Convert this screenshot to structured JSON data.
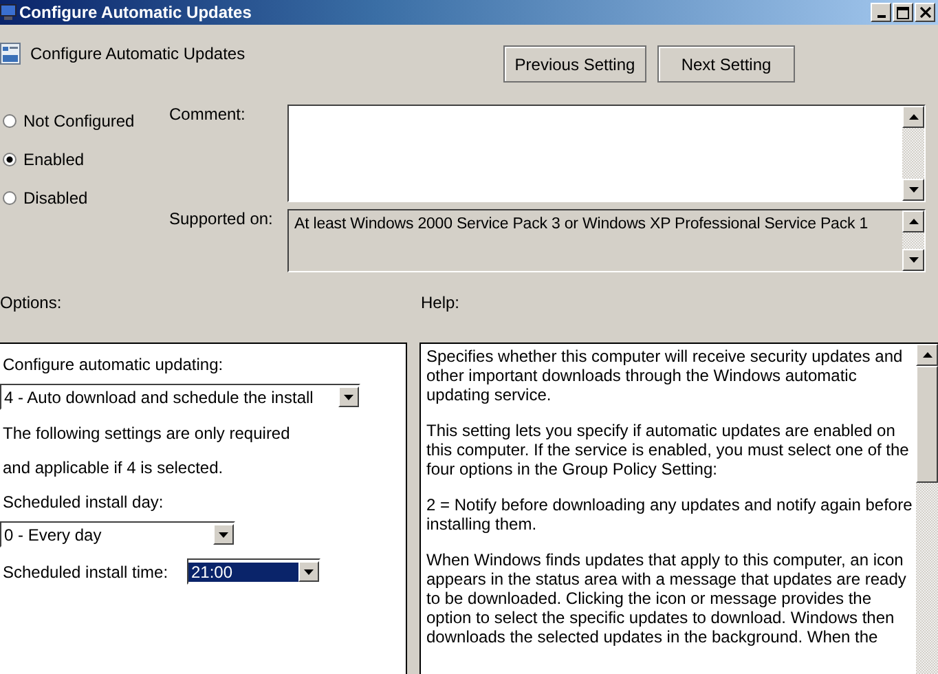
{
  "window": {
    "title": "Configure Automatic Updates"
  },
  "header": {
    "title": "Configure Automatic Updates",
    "buttons": [
      "Previous Setting",
      "Next Setting"
    ]
  },
  "state_options": [
    {
      "label": "Not Configured",
      "selected": false
    },
    {
      "label": "Enabled",
      "selected": true
    },
    {
      "label": "Disabled",
      "selected": false
    }
  ],
  "comment": {
    "label": "Comment:"
  },
  "supported_on": {
    "label": "Supported on:",
    "value": "At least Windows 2000 Service Pack 3 or Windows XP Professional Service Pack 1"
  },
  "options": {
    "label": "Options:",
    "items": [
      {
        "kind": "text",
        "text": "Configure automatic updating:"
      },
      {
        "kind": "dropdown",
        "value": "4 - Auto download and schedule the install"
      },
      {
        "kind": "text",
        "text": "The following settings are only required"
      },
      {
        "kind": "text",
        "text": "and applicable if 4 is selected."
      },
      {
        "kind": "text",
        "text": "Scheduled install day:"
      },
      {
        "kind": "dropdown",
        "value": "0 - Every day"
      },
      {
        "kind": "labeled_dropdown",
        "label": "Scheduled install time:",
        "value": "21:00",
        "focused": true
      }
    ]
  },
  "help": {
    "label": "Help:",
    "paragraphs": [
      "Specifies whether this computer will receive security updates and other important downloads through the Windows automatic updating service.",
      "This setting lets you specify if automatic updates are enabled on this computer. If the service is enabled, you must select one of the four options in the Group Policy Setting:",
      "2 = Notify before downloading any updates and notify again before installing them.",
      "When Windows finds updates that apply to this computer, an icon appears in the status area with a message that updates are ready to be downloaded. Clicking the icon or message provides the option to select the specific updates to download. Windows then downloads the selected updates in the background. When the"
    ]
  }
}
